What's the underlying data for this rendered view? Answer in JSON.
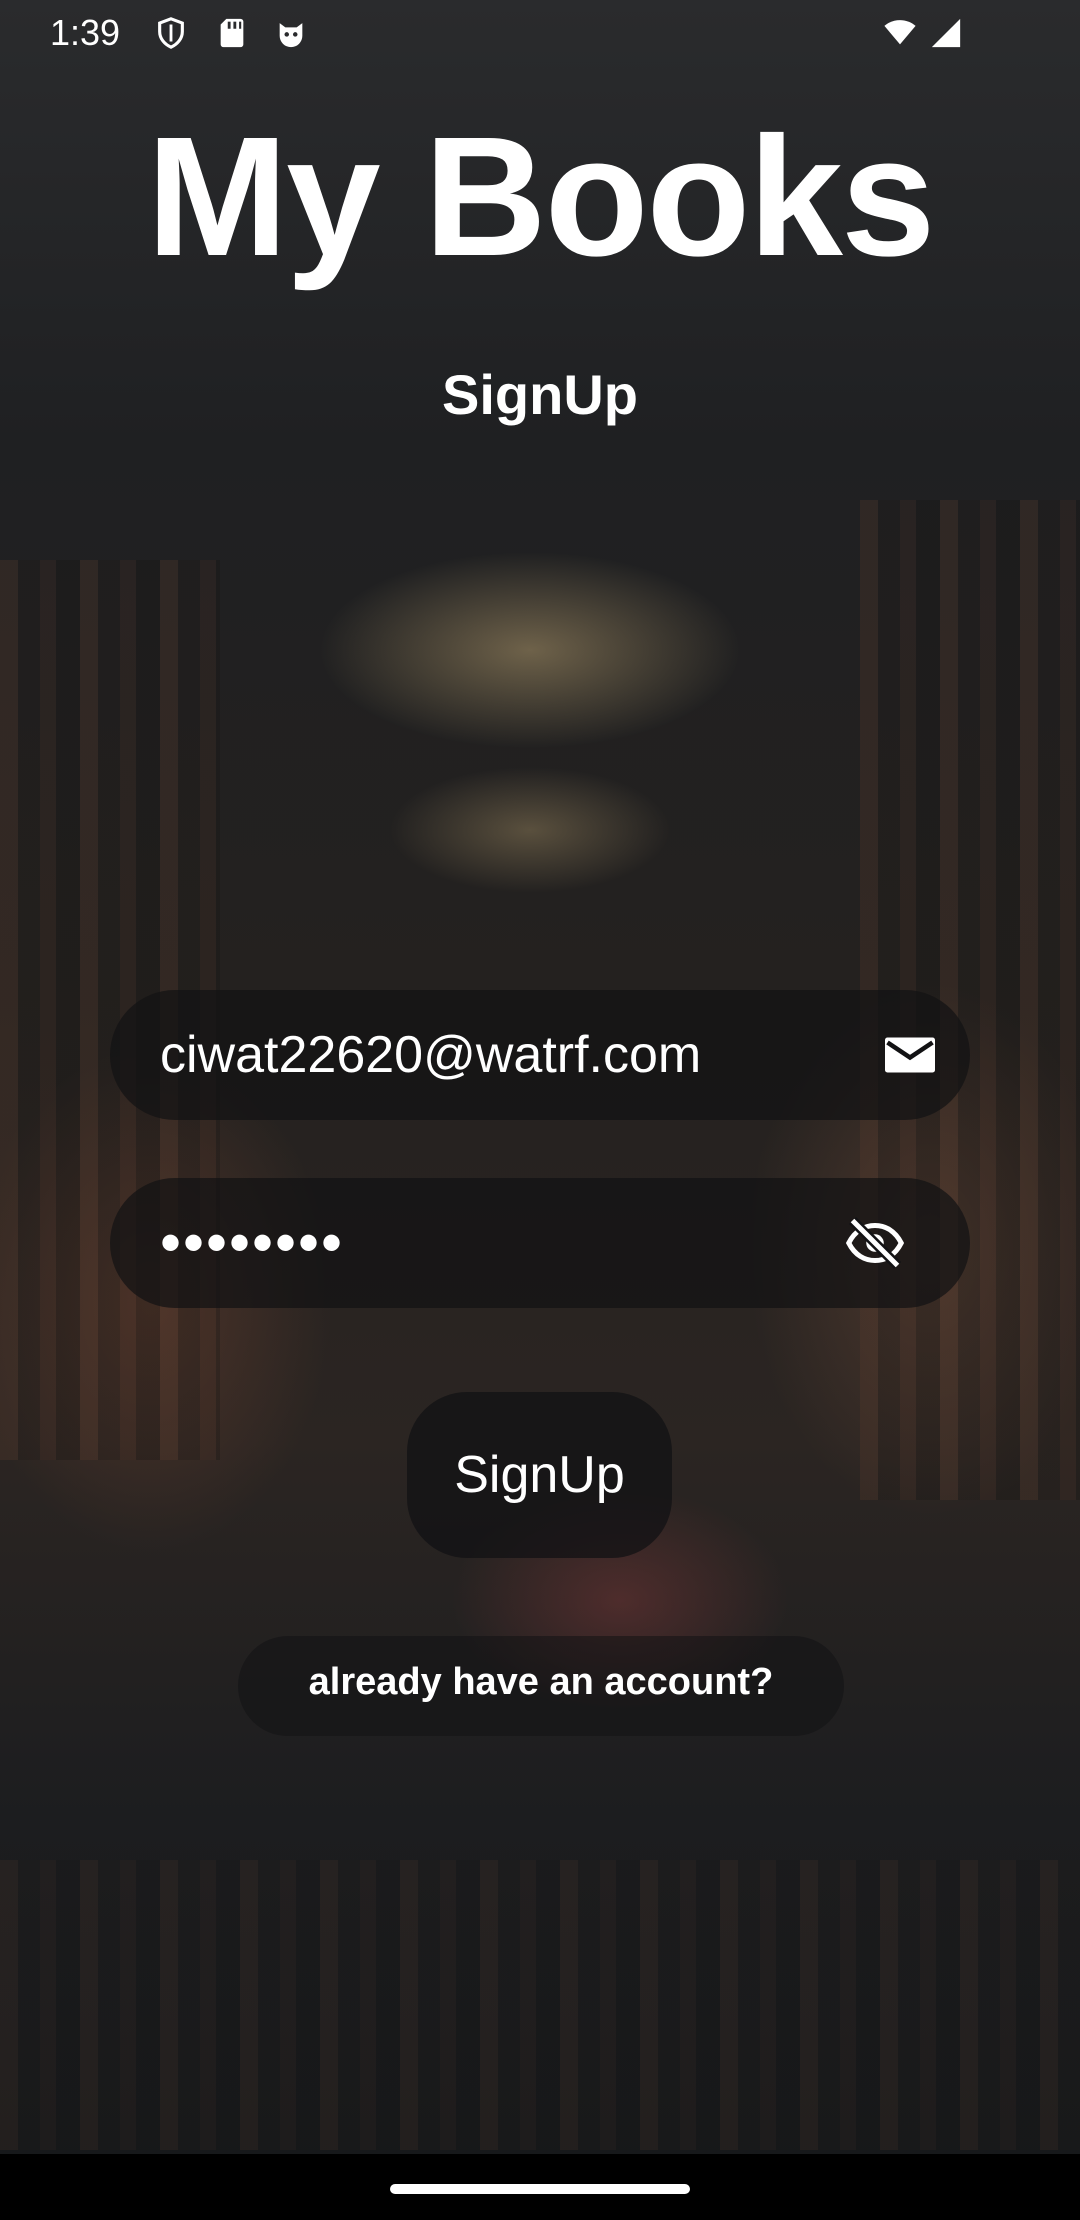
{
  "status_bar": {
    "time": "1:39",
    "icons": [
      "shield-icon",
      "sd-card-icon",
      "cat-face-icon",
      "wifi-icon",
      "signal-icon"
    ]
  },
  "app": {
    "title": "My Books",
    "subtitle": "SignUp"
  },
  "form": {
    "email_value": "ciwat22620@watrf.com",
    "email_icon": "mail-icon",
    "password_value": "••••••••",
    "password_icon": "visibility-off-icon",
    "signup_label": "SignUp",
    "login_link_label": "already have an account?"
  },
  "colors": {
    "text": "#ffffff",
    "field_bg": "#121214",
    "nav_bar": "#000000"
  }
}
